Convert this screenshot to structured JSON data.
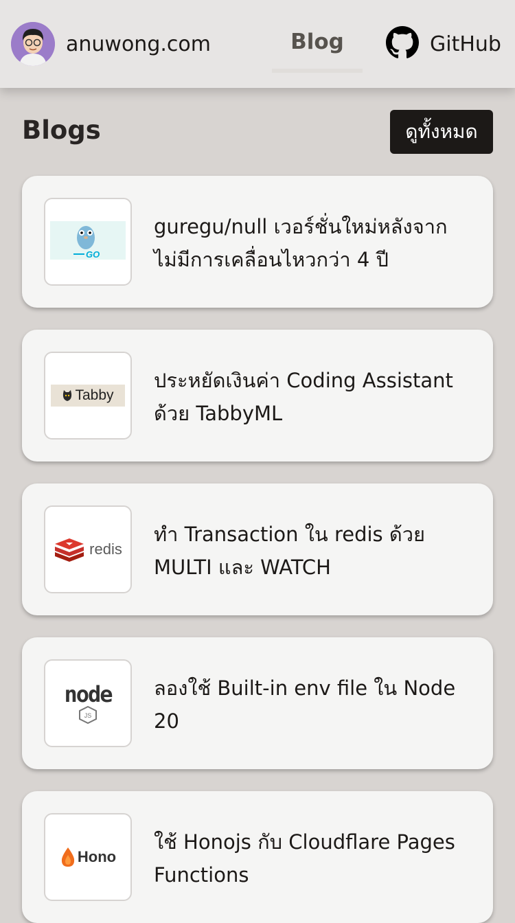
{
  "header": {
    "brand": "anuwong.com",
    "nav_blog": "Blog",
    "nav_github": "GitHub"
  },
  "section": {
    "title": "Blogs",
    "view_all": "ดูทั้งหมด"
  },
  "posts": [
    {
      "title": "guregu/null เวอร์ชั่นใหม่หลังจากไม่มีการเคลื่อนไหวกว่า 4 ปี",
      "thumb": "go-gopher"
    },
    {
      "title": "ประหยัดเงินค่า Coding Assistant ด้วย TabbyML",
      "thumb": "tabby-logo",
      "thumb_text": "Tabby"
    },
    {
      "title": "ทำ Transaction ใน redis ด้วย MULTI และ WATCH",
      "thumb": "redis-logo",
      "thumb_text": "redis"
    },
    {
      "title": "ลองใช้ Built-in env file ใน Node 20",
      "thumb": "nodejs-logo",
      "thumb_text": "node"
    },
    {
      "title": "ใช้ Honojs กับ Cloudflare Pages Functions",
      "thumb": "hono-logo",
      "thumb_text": "Hono"
    }
  ]
}
